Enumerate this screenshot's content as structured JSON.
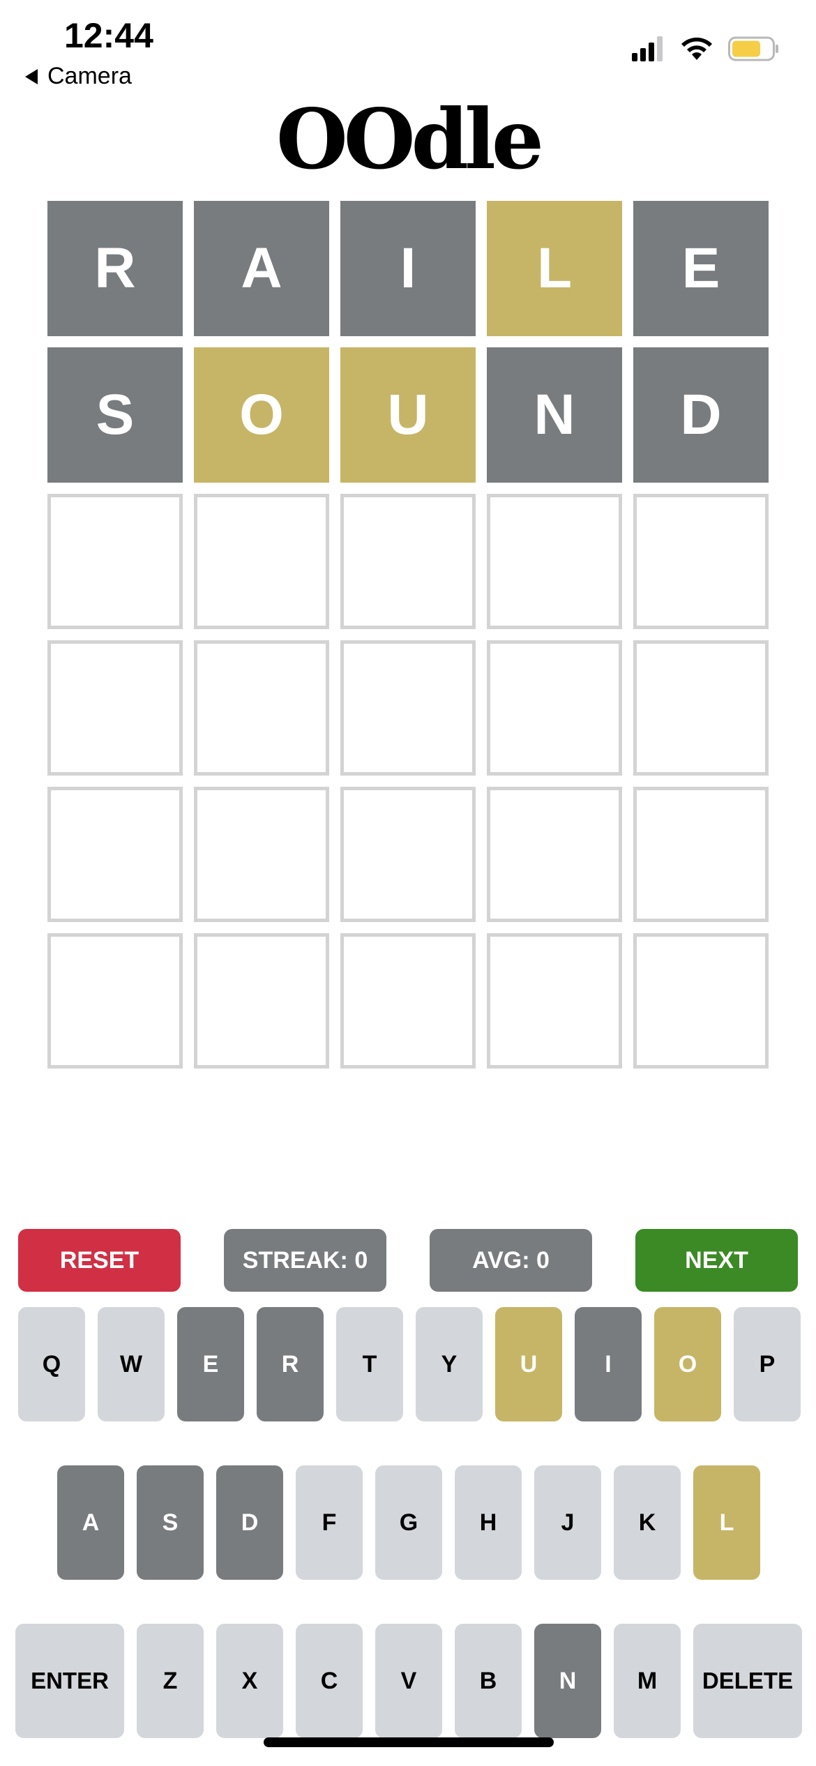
{
  "status_bar": {
    "time": "12:44",
    "back_label": "Camera",
    "icons": [
      "signal-icon",
      "wifi-icon",
      "battery-icon"
    ],
    "battery_color": "#f5cd47"
  },
  "title": "OOdle",
  "colors": {
    "absent": "#787c7e",
    "present": "#c6b566",
    "empty_border": "#d3d3d3",
    "key_default": "#d3d6da",
    "reset": "#d12f44",
    "stat": "#787c7e",
    "next": "#3b8a25"
  },
  "board": {
    "rows": [
      [
        {
          "letter": "R",
          "state": "absent"
        },
        {
          "letter": "A",
          "state": "absent"
        },
        {
          "letter": "I",
          "state": "absent"
        },
        {
          "letter": "L",
          "state": "present"
        },
        {
          "letter": "E",
          "state": "absent"
        }
      ],
      [
        {
          "letter": "S",
          "state": "absent"
        },
        {
          "letter": "O",
          "state": "present"
        },
        {
          "letter": "U",
          "state": "present"
        },
        {
          "letter": "N",
          "state": "absent"
        },
        {
          "letter": "D",
          "state": "absent"
        }
      ],
      [
        {
          "letter": "",
          "state": "empty"
        },
        {
          "letter": "",
          "state": "empty"
        },
        {
          "letter": "",
          "state": "empty"
        },
        {
          "letter": "",
          "state": "empty"
        },
        {
          "letter": "",
          "state": "empty"
        }
      ],
      [
        {
          "letter": "",
          "state": "empty"
        },
        {
          "letter": "",
          "state": "empty"
        },
        {
          "letter": "",
          "state": "empty"
        },
        {
          "letter": "",
          "state": "empty"
        },
        {
          "letter": "",
          "state": "empty"
        }
      ],
      [
        {
          "letter": "",
          "state": "empty"
        },
        {
          "letter": "",
          "state": "empty"
        },
        {
          "letter": "",
          "state": "empty"
        },
        {
          "letter": "",
          "state": "empty"
        },
        {
          "letter": "",
          "state": "empty"
        }
      ],
      [
        {
          "letter": "",
          "state": "empty"
        },
        {
          "letter": "",
          "state": "empty"
        },
        {
          "letter": "",
          "state": "empty"
        },
        {
          "letter": "",
          "state": "empty"
        },
        {
          "letter": "",
          "state": "empty"
        }
      ]
    ]
  },
  "actions": {
    "reset": "RESET",
    "streak": "STREAK: 0",
    "avg": "AVG: 0",
    "next": "NEXT"
  },
  "keyboard": {
    "rows": [
      [
        {
          "label": "Q",
          "state": "default"
        },
        {
          "label": "W",
          "state": "default"
        },
        {
          "label": "E",
          "state": "absent"
        },
        {
          "label": "R",
          "state": "absent"
        },
        {
          "label": "T",
          "state": "default"
        },
        {
          "label": "Y",
          "state": "default"
        },
        {
          "label": "U",
          "state": "present"
        },
        {
          "label": "I",
          "state": "absent"
        },
        {
          "label": "O",
          "state": "present"
        },
        {
          "label": "P",
          "state": "default"
        }
      ],
      [
        {
          "label": "A",
          "state": "absent"
        },
        {
          "label": "S",
          "state": "absent"
        },
        {
          "label": "D",
          "state": "absent"
        },
        {
          "label": "F",
          "state": "default"
        },
        {
          "label": "G",
          "state": "default"
        },
        {
          "label": "H",
          "state": "default"
        },
        {
          "label": "J",
          "state": "default"
        },
        {
          "label": "K",
          "state": "default"
        },
        {
          "label": "L",
          "state": "present"
        }
      ],
      [
        {
          "label": "ENTER",
          "state": "default",
          "wide": true
        },
        {
          "label": "Z",
          "state": "default"
        },
        {
          "label": "X",
          "state": "default"
        },
        {
          "label": "C",
          "state": "default"
        },
        {
          "label": "V",
          "state": "default"
        },
        {
          "label": "B",
          "state": "default"
        },
        {
          "label": "N",
          "state": "absent"
        },
        {
          "label": "M",
          "state": "default"
        },
        {
          "label": "DELETE",
          "state": "default",
          "wide": true
        }
      ]
    ]
  }
}
